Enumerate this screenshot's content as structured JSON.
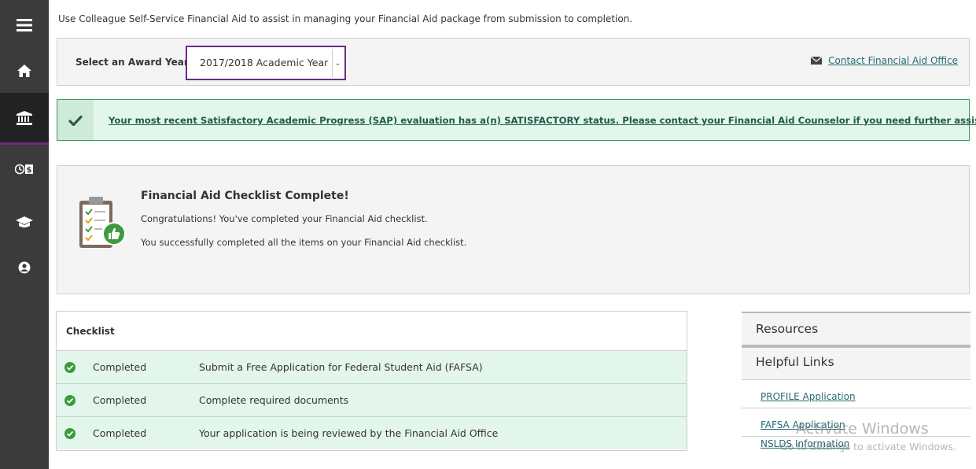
{
  "sidebar": {
    "items": [
      {
        "icon": "menu-icon"
      },
      {
        "icon": "home-icon"
      },
      {
        "icon": "bank-icon",
        "active": true
      },
      {
        "icon": "clock-dollar-icon"
      },
      {
        "icon": "graduation-cap-icon"
      },
      {
        "icon": "user-circle-icon"
      }
    ],
    "accent": "#6b2d83"
  },
  "intro": "Use Colleague Self-Service Financial Aid to assist in managing your Financial Aid package from submission to completion.",
  "award_year": {
    "label": "Select an Award Year:",
    "selected": "2017/2018 Academic Year"
  },
  "contact": {
    "icon": "envelope-icon",
    "label": "Contact Financial Aid Office"
  },
  "sap_banner": {
    "icon": "checkmark-icon",
    "text": "Your most recent Satisfactory Academic Progress (SAP) evaluation has a(n) SATISFACTORY status. Please contact your Financial Aid Counselor if you need further assistance.",
    "color": "#3b9a57"
  },
  "checklist_complete": {
    "icon": "clipboard-thumbs-up-icon",
    "title": "Financial Aid Checklist Complete!",
    "line1": "Congratulations! You've completed your Financial Aid checklist.",
    "line2": "You successfully completed all the items on your Financial Aid checklist."
  },
  "checklist": {
    "header": "Checklist",
    "rows": [
      {
        "status": "Completed",
        "description": "Submit a Free Application for Federal Student Aid (FAFSA)"
      },
      {
        "status": "Completed",
        "description": "Complete required documents"
      },
      {
        "status": "Completed",
        "description": "Your application is being reviewed by the Financial Aid Office"
      }
    ]
  },
  "resources": {
    "title": "Resources",
    "helpful_links_title": "Helpful Links",
    "links": [
      "PROFILE Application",
      "FAFSA Application",
      "NSLDS Information"
    ]
  },
  "watermark": {
    "line1": "Activate Windows",
    "line2": "Go to Settings to activate Windows."
  }
}
